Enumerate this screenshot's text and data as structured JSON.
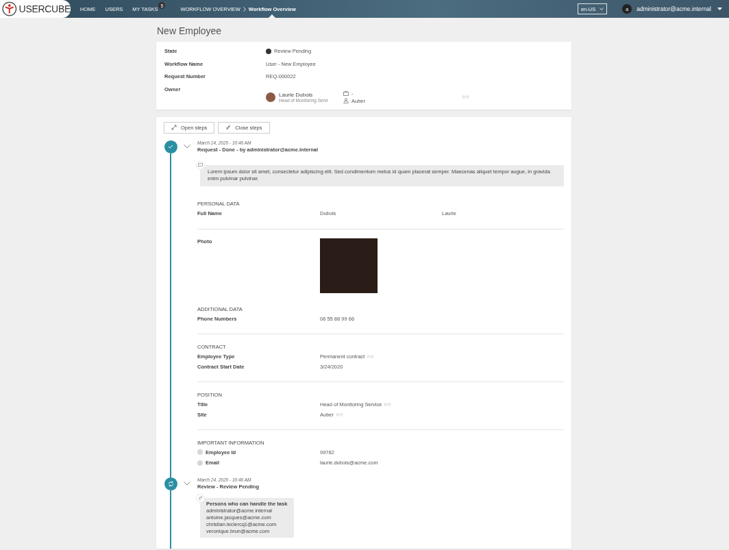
{
  "nav": {
    "logo": "USERCUBE",
    "items": [
      {
        "label": "HOME"
      },
      {
        "label": "USERS"
      },
      {
        "label": "MY TASKS",
        "badge": "5"
      }
    ],
    "breadcrumb": [
      {
        "label": "WORKFLOW OVERVIEW",
        "selected": false
      },
      {
        "label": "Workflow Overview",
        "selected": true
      }
    ],
    "language": "en-US",
    "user": {
      "initial": "a",
      "name": "administrator@acme.internal"
    }
  },
  "page_title": "New Employee",
  "summary": {
    "rows": [
      {
        "label": "State",
        "kind": "state",
        "value": "Review Pending"
      },
      {
        "label": "Workflow Name",
        "kind": "text",
        "value": "User - New Employee"
      },
      {
        "label": "Request Number",
        "kind": "text",
        "value": "REQ-000022"
      },
      {
        "label": "Owner",
        "kind": "owner",
        "name": "Laurie Dubois",
        "subtitle": "Head of Monitoring Servi",
        "organization": "-",
        "site": "Auber"
      }
    ]
  },
  "toolbar": [
    {
      "label": "Open steps",
      "kind": "open"
    },
    {
      "label": "Close steps",
      "kind": "close"
    }
  ],
  "steps": [
    {
      "kind": "done",
      "expanded": true,
      "date": "March 24, 2020  - 10:46 AM",
      "title": "Request - Done - by administrator@acme.internal",
      "comment": "Lorem ipsum dolor sit amet, consectetur adipiscing elit. Sed condimentum metus id quam placerat semper. Maecenas aliquet tempor augue, in gravida enim pulvinar pulvinar.",
      "sections": [
        {
          "title": "PERSONAL DATA",
          "rows": [
            {
              "label": "Full Name",
              "kind": "text",
              "values": [
                "Dubois",
                "Laurie"
              ]
            },
            {
              "label": "Photo",
              "kind": "photo"
            }
          ]
        },
        {
          "title": "ADDITIONAL DATA",
          "rows": [
            {
              "label": "Phone Numbers",
              "kind": "text",
              "values": [
                "06 55 88 99 66"
              ]
            }
          ]
        },
        {
          "title": "CONTRACT",
          "divider": true,
          "rows": [
            {
              "label": "Employee Type",
              "kind": "text",
              "values": [
                "Permanent contract"
              ],
              "linked": true
            },
            {
              "label": "Contract Start Date",
              "kind": "text",
              "values": [
                "3/24/2020"
              ]
            }
          ]
        },
        {
          "title": "POSITION",
          "divider": true,
          "rows": [
            {
              "label": "Title",
              "kind": "text",
              "values": [
                "Head of Monitoring Service"
              ],
              "linked": true
            },
            {
              "label": "Site",
              "kind": "text",
              "values": [
                "Auber"
              ],
              "linked": true
            }
          ]
        },
        {
          "title": "IMPORTANT INFORMATION",
          "divider": true,
          "important": true,
          "rows": [
            {
              "label": "Employee Id",
              "kind": "text",
              "values": [
                "99782"
              ]
            },
            {
              "label": "Email",
              "kind": "text",
              "values": [
                "laurie.dubois@acme.com"
              ]
            }
          ]
        }
      ]
    },
    {
      "kind": "pending",
      "expanded": true,
      "date": "March 24, 2020  - 10:46 AM",
      "title": "Review - Review Pending",
      "handlers": {
        "title": "Persons who can handle the task",
        "emails": [
          "administrator@acme.internal",
          "antoine.jacques@acme.com",
          "christian.leclercq1@acme.com",
          "veronique.brun@acme.com"
        ]
      }
    }
  ]
}
